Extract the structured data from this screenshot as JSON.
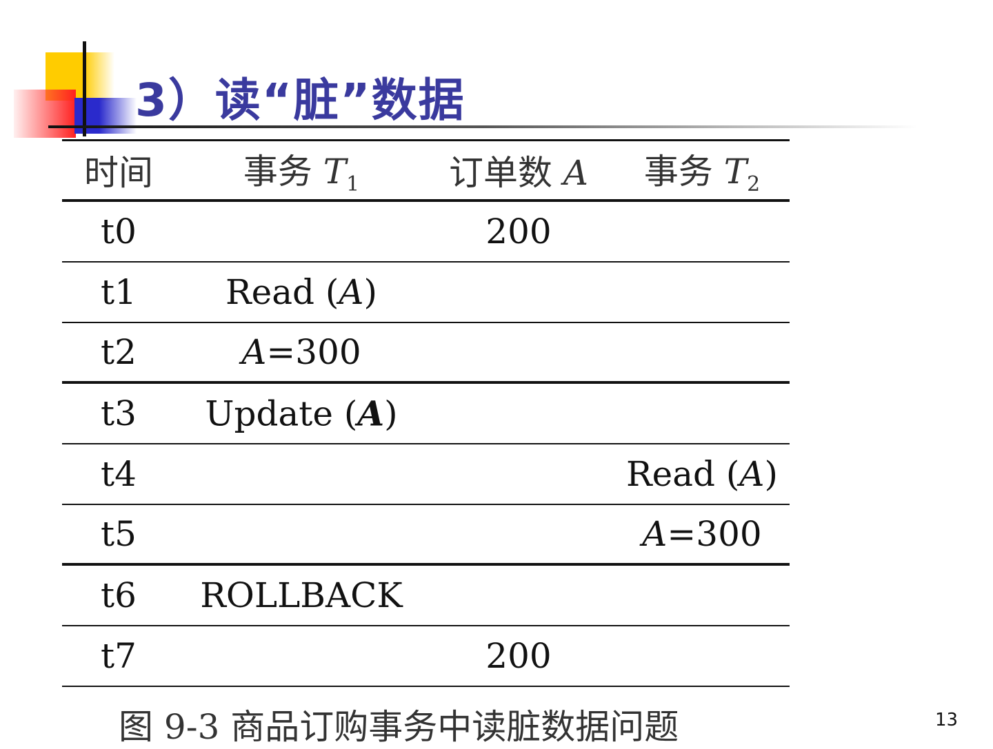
{
  "title": "3）读“脏”数据",
  "table": {
    "header": [
      [
        {
          "t": "时间"
        }
      ],
      [
        {
          "t": "事务 "
        },
        {
          "t": "T",
          "i": true
        },
        {
          "t": "1",
          "sub": true
        }
      ],
      [
        {
          "t": "订单数 "
        },
        {
          "t": "A",
          "i": true
        }
      ],
      [
        {
          "t": "事务 "
        },
        {
          "t": "T",
          "i": true
        },
        {
          "t": "2",
          "sub": true
        }
      ]
    ],
    "rows": [
      {
        "time": "t0",
        "cells": [
          [],
          [
            {
              "t": "200"
            }
          ],
          []
        ]
      },
      {
        "time": "t1",
        "cells": [
          [
            {
              "t": "Read ("
            },
            {
              "t": "A",
              "i": true
            },
            {
              "t": ")"
            }
          ],
          [],
          []
        ]
      },
      {
        "time": "t2",
        "cells": [
          [
            {
              "t": "A",
              "i": true
            },
            {
              "t": "=300"
            }
          ],
          [],
          []
        ]
      },
      {
        "time": "t3",
        "cells": [
          [
            {
              "t": "Update ("
            },
            {
              "t": "A",
              "i": true,
              "b": true
            },
            {
              "t": ")"
            }
          ],
          [],
          []
        ]
      },
      {
        "time": "t4",
        "cells": [
          [],
          [],
          [
            {
              "t": "Read ("
            },
            {
              "t": "A",
              "i": true
            },
            {
              "t": ")"
            }
          ]
        ]
      },
      {
        "time": "t5",
        "cells": [
          [],
          [],
          [
            {
              "t": "A",
              "i": true
            },
            {
              "t": "=300"
            }
          ]
        ]
      },
      {
        "time": "t6",
        "cells": [
          [
            {
              "t": "ROLLBACK"
            }
          ],
          [],
          []
        ]
      },
      {
        "time": "t7",
        "cells": [
          [],
          [
            {
              "t": "200"
            }
          ],
          []
        ]
      }
    ]
  },
  "caption": "图 9-3  商品订购事务中读脏数据问题",
  "page_number": "13",
  "colors": {
    "title": "#3a3a9e",
    "logo_yellow": "#ffcc00",
    "logo_red": "#ff2020",
    "logo_blue": "#2a2acc"
  }
}
